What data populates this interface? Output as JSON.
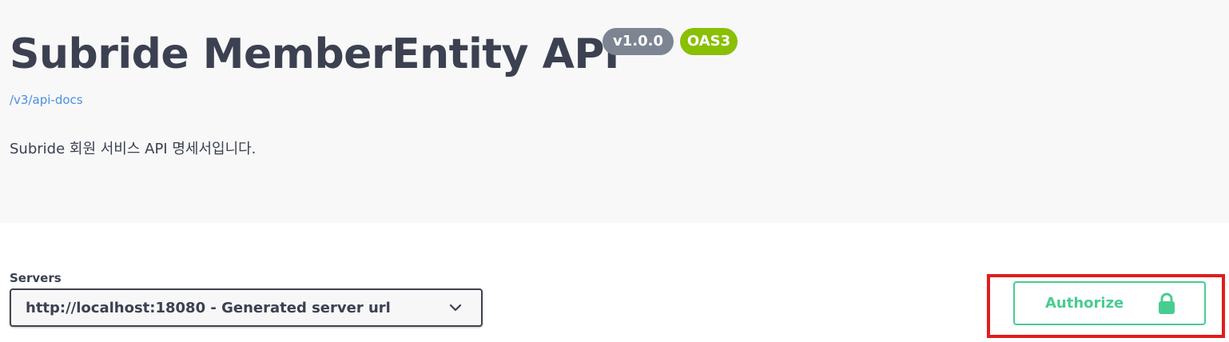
{
  "info": {
    "title": "Subride MemberEntity API",
    "version_badge": "v1.0.0",
    "spec_badge": "OAS3",
    "docs_link": "/v3/api-docs",
    "description": "Subride 회원 서비스 API 명세서입니다."
  },
  "servers": {
    "label": "Servers",
    "selected": "http://localhost:18080 - Generated server url",
    "icon": "chevron-down-icon"
  },
  "authorize": {
    "label": "Authorize",
    "icon": "lock-icon"
  },
  "colors": {
    "title_text": "#3b4151",
    "version_badge_bg": "#7d8492",
    "spec_badge_bg": "#89bf04",
    "link": "#4990e2",
    "authorize_green": "#49cc90",
    "highlight_red": "#e21c1c",
    "info_background": "#f8f8f8"
  }
}
